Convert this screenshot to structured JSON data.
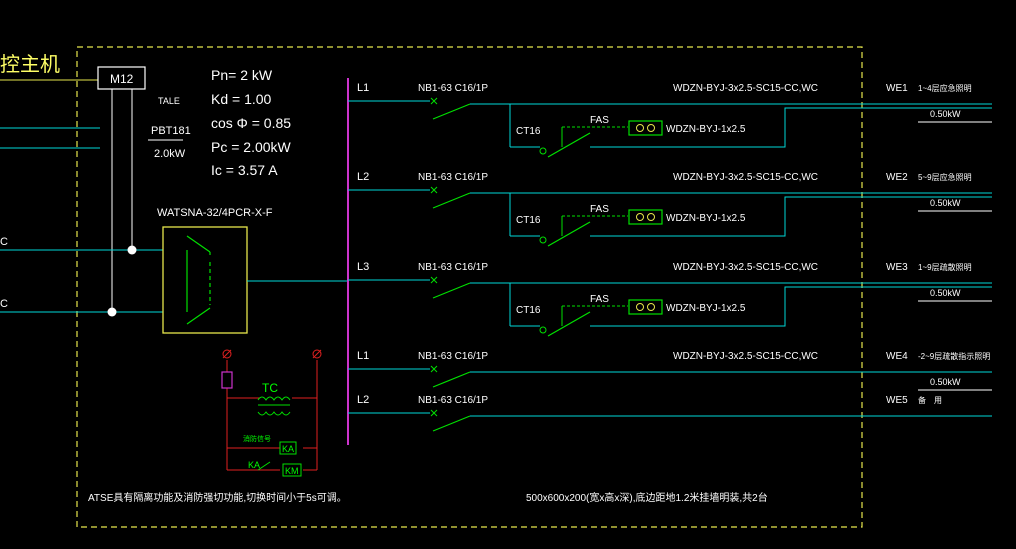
{
  "colors": {
    "background": "#000000",
    "border": "#e6e64c",
    "cyan": "#00d8d8",
    "green": "#00e000",
    "magenta": "#cc33cc",
    "red": "#e02020",
    "white": "#ffffff",
    "yellow": "#ffff66"
  },
  "header": {
    "title_fragment": "控主机"
  },
  "box_m12": "M12",
  "tale_label": "TALE",
  "pbt": {
    "name": "PBT181",
    "power": "2.0kW"
  },
  "params": {
    "pn": "Pn= 2 kW",
    "kd": "Kd = 1.00",
    "cos": "cos Φ = 0.85",
    "pc": "Pc = 2.00kW",
    "ic": "Ic = 3.57 A"
  },
  "ats_label": "WATSNA-32/4PCR-X-F",
  "left_marks": [
    "C",
    "C"
  ],
  "tc": {
    "label": "TC",
    "ka": "KA",
    "km": "KM",
    "ka2": "KA",
    "small": "消防信号"
  },
  "circuits": [
    {
      "phase": "L1",
      "breaker": "NB1-63 C16/1P",
      "cable": "WDZN-BYJ-3x2.5-SC15-CC,WC",
      "id": "WE1",
      "desc": "1~4层应急照明",
      "power": "0.50kW",
      "ct": "CT16",
      "fas": "FAS",
      "fas_cable": "WDZN-BYJ-1x2.5"
    },
    {
      "phase": "L2",
      "breaker": "NB1-63 C16/1P",
      "cable": "WDZN-BYJ-3x2.5-SC15-CC,WC",
      "id": "WE2",
      "desc": "5~9层应急照明",
      "power": "0.50kW",
      "ct": "CT16",
      "fas": "FAS",
      "fas_cable": "WDZN-BYJ-1x2.5"
    },
    {
      "phase": "L3",
      "breaker": "NB1-63 C16/1P",
      "cable": "WDZN-BYJ-3x2.5-SC15-CC,WC",
      "id": "WE3",
      "desc": "1~9层疏散照明",
      "power": "0.50kW",
      "ct": "CT16",
      "fas": "FAS",
      "fas_cable": "WDZN-BYJ-1x2.5"
    },
    {
      "phase": "L1",
      "breaker": "NB1-63 C16/1P",
      "cable": "WDZN-BYJ-3x2.5-SC15-CC,WC",
      "id": "WE4",
      "desc": "-2~9层疏散指示照明",
      "power": "0.50kW"
    },
    {
      "phase": "L2",
      "breaker": "NB1-63 C16/1P",
      "cable": "",
      "id": "WE5",
      "desc": "备　用",
      "power": ""
    }
  ],
  "footer": {
    "note_left": "ATSE具有隔离功能及消防强切功能,切换时间小于5s可调。",
    "note_right": "500x600x200(宽x高x深),底边距地1.2米挂墙明装,共2台"
  }
}
